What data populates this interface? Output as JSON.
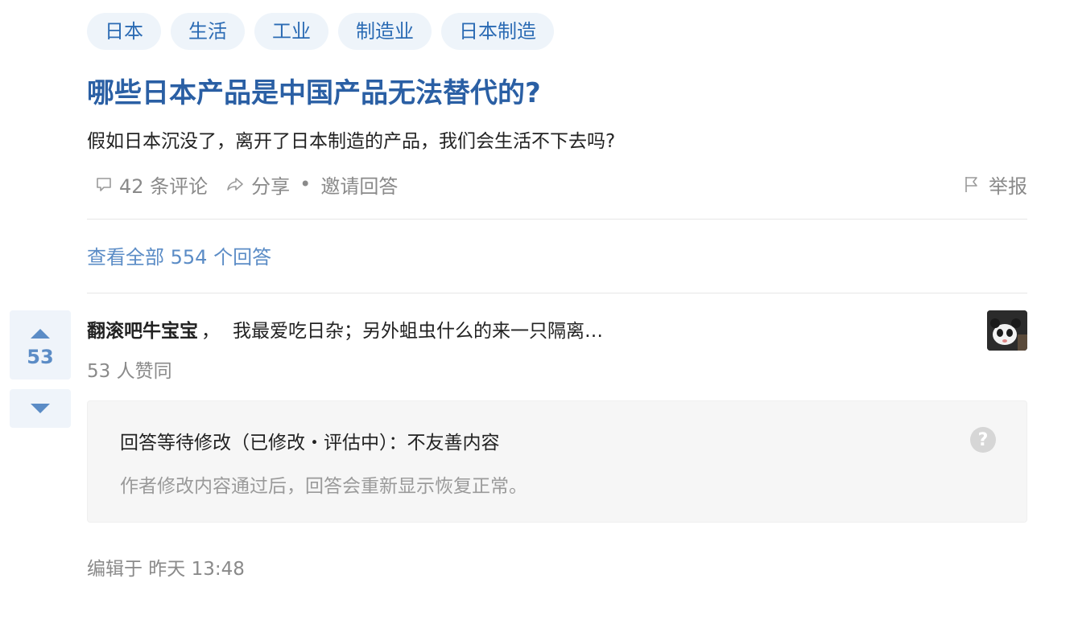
{
  "tags": [
    "日本",
    "生活",
    "工业",
    "制造业",
    "日本制造"
  ],
  "question": {
    "title": "哪些日本产品是中国产品无法替代的?",
    "detail": "假如日本沉没了，离开了日本制造的产品，我们会生活不下去吗?"
  },
  "meta": {
    "comments": "42 条评论",
    "share": "分享",
    "dot": "•",
    "invite": "邀请回答",
    "report": "举报"
  },
  "view_all": "查看全部 554 个回答",
  "answer": {
    "votes": "53",
    "author": "翻滚吧牛宝宝",
    "separator": "，",
    "excerpt": "我最爱吃日杂；另外蛆虫什么的来一只隔离…",
    "likes": "53 人赞同",
    "notice_title": "回答等待修改（已修改・评估中）：不友善内容",
    "notice_body": "作者修改内容通过后，回答会重新显示恢复正常。",
    "help": "?",
    "edited": "编辑于 昨天 13:48"
  },
  "colors": {
    "link": "#2a5fa4",
    "tag_bg": "#eef4fa",
    "vote_bg": "#eff4fa",
    "muted": "#8a8a8a"
  },
  "icons": [
    "comment-icon",
    "share-icon",
    "flag-icon",
    "vote-up-icon",
    "vote-down-icon",
    "help-icon"
  ]
}
